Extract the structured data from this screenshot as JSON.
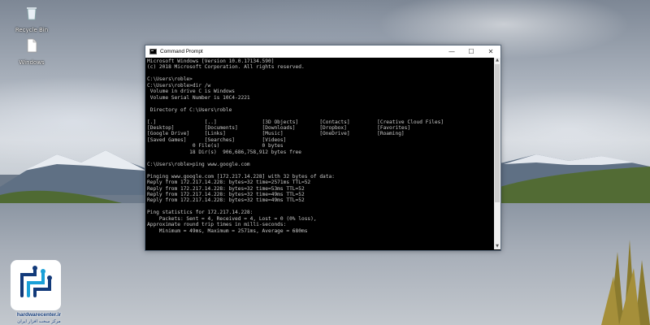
{
  "desktop": {
    "icons": [
      {
        "label": "Recycle Bin",
        "icon": "recycle-bin-icon"
      },
      {
        "label": "Windows",
        "icon": "document-icon"
      }
    ]
  },
  "window": {
    "title": "Command Prompt",
    "controls": {
      "minimize": "—",
      "maximize": "☐",
      "close": "✕"
    },
    "console_lines": [
      "Microsoft Windows [Version 10.0.17134.590]",
      "(c) 2018 Microsoft Corporation. All rights reserved.",
      "",
      "C:\\Users\\roble>",
      "C:\\Users\\roble>dir /w",
      " Volume in drive C is Windows",
      " Volume Serial Number is 10C4-2221",
      "",
      " Directory of C:\\Users\\roble",
      "",
      "[.]                [..]               [3D Objects]       [Contacts]         [Creative Cloud Files]",
      "[Desktop]          [Documents]        [Downloads]        [Dropbox]          [Favorites]",
      "[Google Drive]     [Links]            [Music]            [OneDrive]         [Roaming]",
      "[Saved Games]      [Searches]         [Videos]",
      "               0 File(s)              0 bytes",
      "              18 Dir(s)  906,686,758,912 bytes free",
      "",
      "C:\\Users\\roble>ping www.google.com",
      "",
      "Pinging www.google.com [172.217.14.228] with 32 bytes of data:",
      "Reply from 172.217.14.228: bytes=32 time=2571ms TTL=52",
      "Reply from 172.217.14.228: bytes=32 time=53ms TTL=52",
      "Reply from 172.217.14.228: bytes=32 time=49ms TTL=52",
      "Reply from 172.217.14.228: bytes=32 time=49ms TTL=52",
      "",
      "Ping statistics for 172.217.14.228:",
      "    Packets: Sent = 4, Received = 4, Lost = 0 (0% loss),",
      "Approximate round trip times in milli-seconds:",
      "    Minimum = 49ms, Maximum = 2571ms, Average = 680ms"
    ]
  },
  "watermark": {
    "site": "hardwarecenter.ir",
    "subtitle": "مرکز سخت افزار ایران"
  },
  "colors": {
    "console_bg": "#000000",
    "console_text": "#c9c9c9",
    "titlebar_bg": "#ffffff",
    "watermark_blue": "#123a7a",
    "watermark_accent": "#1aa0d8"
  }
}
